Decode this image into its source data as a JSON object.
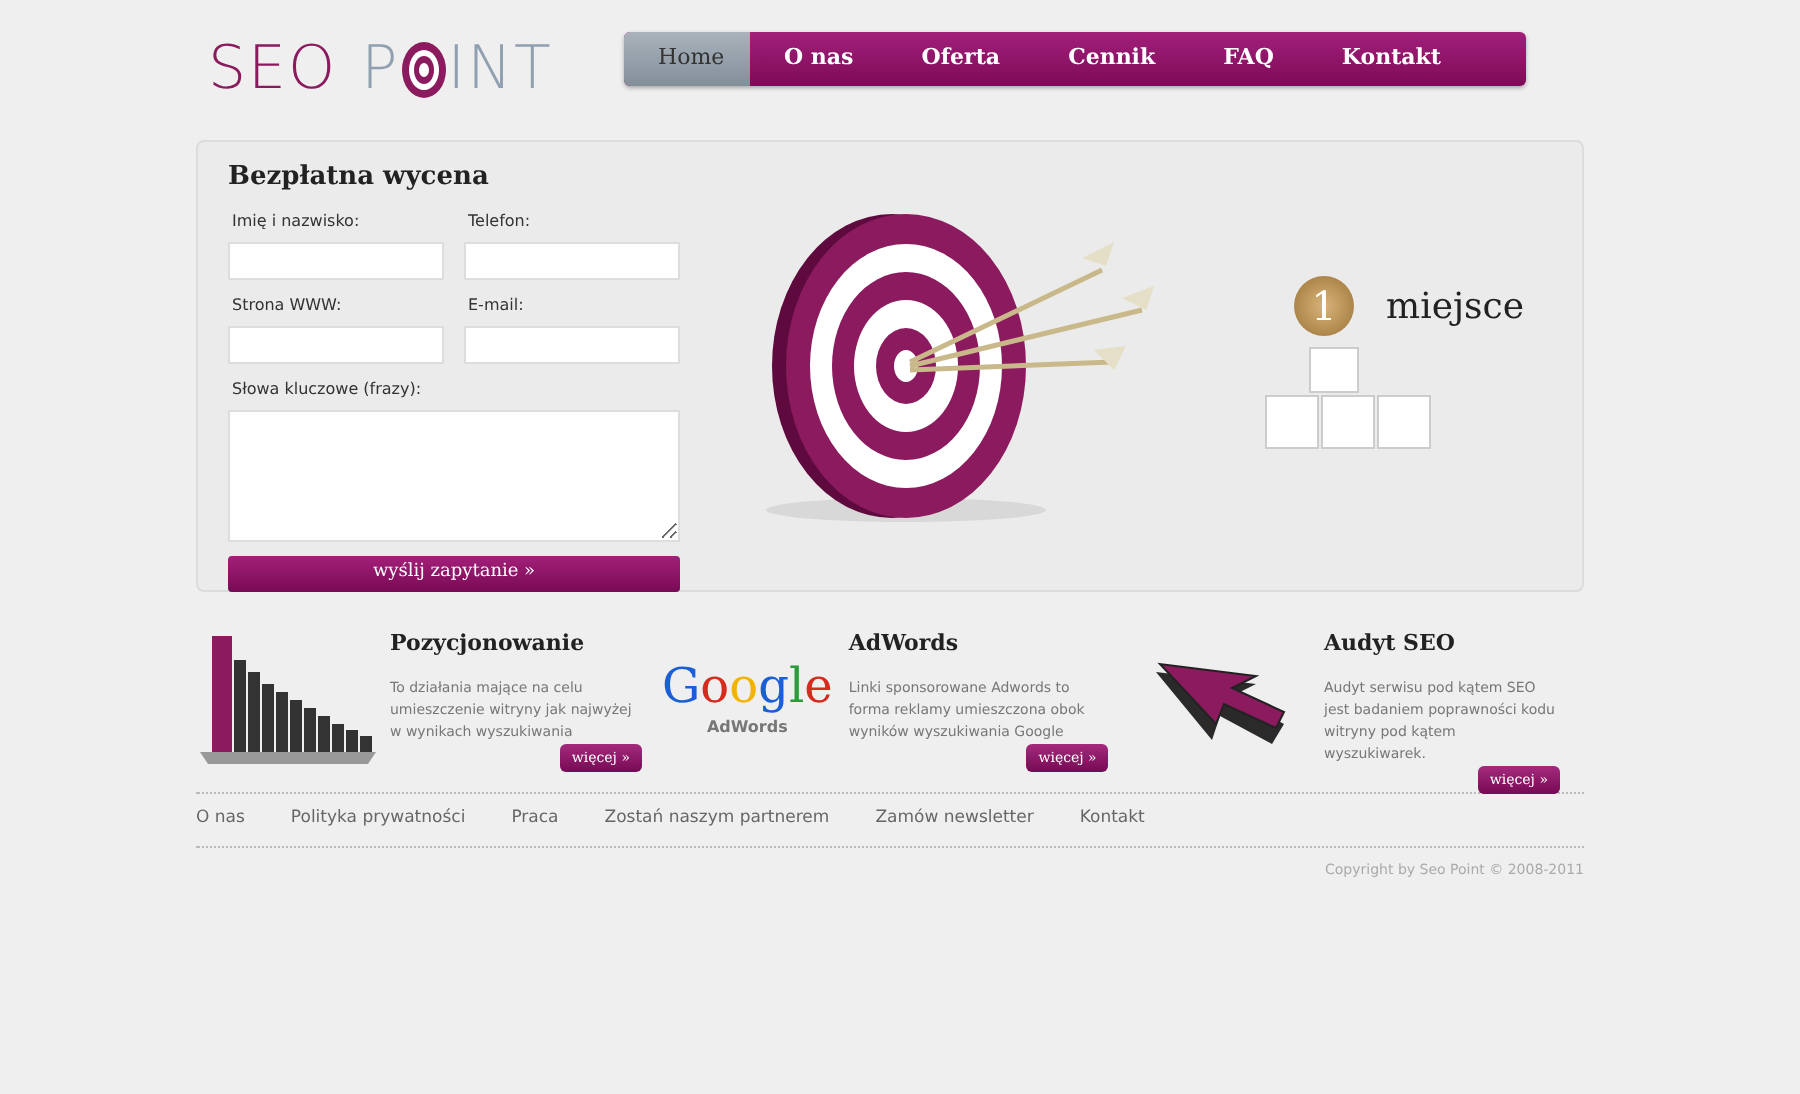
{
  "logo": {
    "first_word": "SEO",
    "second_word_start": "P",
    "second_word_end": "INT"
  },
  "nav": [
    {
      "label": "Home",
      "selected": true
    },
    {
      "label": "O nas",
      "selected": false
    },
    {
      "label": "Oferta",
      "selected": false
    },
    {
      "label": "Cennik",
      "selected": false
    },
    {
      "label": "FAQ",
      "selected": false
    },
    {
      "label": "Kontakt",
      "selected": false
    }
  ],
  "quote_form": {
    "title": "Bezpłatna wycena",
    "fields": [
      {
        "label": "Imię i nazwisko:",
        "kind": "input"
      },
      {
        "label": "Telefon:",
        "kind": "input"
      },
      {
        "label": "Strona WWW:",
        "kind": "input"
      },
      {
        "label": "E-mail:",
        "kind": "input"
      },
      {
        "label": "Słowa kluczowe (frazy):",
        "kind": "textarea"
      }
    ],
    "submit": "wyślij zapytanie  »"
  },
  "hero": {
    "medal": "1",
    "caption": "miejsce"
  },
  "services": [
    {
      "kind": "chart",
      "title": "Pozycjonowanie",
      "text": "To działania mające na celu umieszczenie witryny jak najwyżej w wynikach wyszukiwania",
      "button": "więcej  »"
    },
    {
      "kind": "google",
      "logo_word": "Google",
      "logo_sub": "AdWords",
      "title": "AdWords",
      "text": "Linki sponsorowane Adwords to forma reklamy umieszczona obok wyników wyszukiwania Google",
      "button": "więcej  »"
    },
    {
      "kind": "cursor",
      "title": "Audyt SEO",
      "text": "Audyt serwisu pod kątem SEO jest badaniem poprawności kodu witryny pod kątem wyszukiwarek.",
      "button": "więcej  »"
    }
  ],
  "footer_links": [
    "O nas",
    "Polityka prywatności",
    "Praca",
    "Zostań naszym partnerem",
    "Zamów newsletter",
    "Kontakt"
  ],
  "copyright": "Copyright by Seo Point © 2008-2011"
}
